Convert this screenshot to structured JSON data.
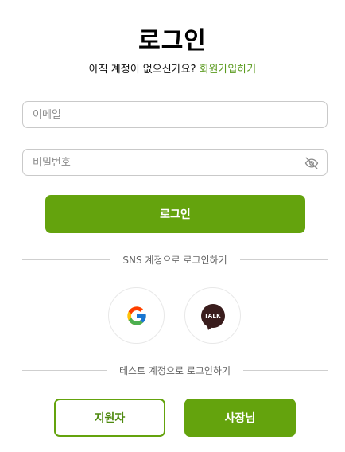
{
  "title": "로그인",
  "subtitle": {
    "question": "아직 계정이 없으신가요?",
    "signup_link": "회원가입하기"
  },
  "form": {
    "email_placeholder": "이메일",
    "email_value": "",
    "password_placeholder": "비밀번호",
    "password_value": "",
    "password_toggle_icon": "eye-off-icon",
    "login_button": "로그인"
  },
  "sns": {
    "divider_label": "SNS 계정으로 로그인하기",
    "providers": [
      {
        "name": "google",
        "icon": "google-icon"
      },
      {
        "name": "kakao",
        "icon": "kakao-talk-icon",
        "badge_text": "TALK"
      }
    ]
  },
  "test": {
    "divider_label": "테스트 계정으로 로그인하기",
    "applicant_button": "지원자",
    "owner_button": "사장님"
  },
  "colors": {
    "accent": "#64a30d",
    "link": "#5a9a1e",
    "kakao_badge": "#3a1d1d"
  }
}
